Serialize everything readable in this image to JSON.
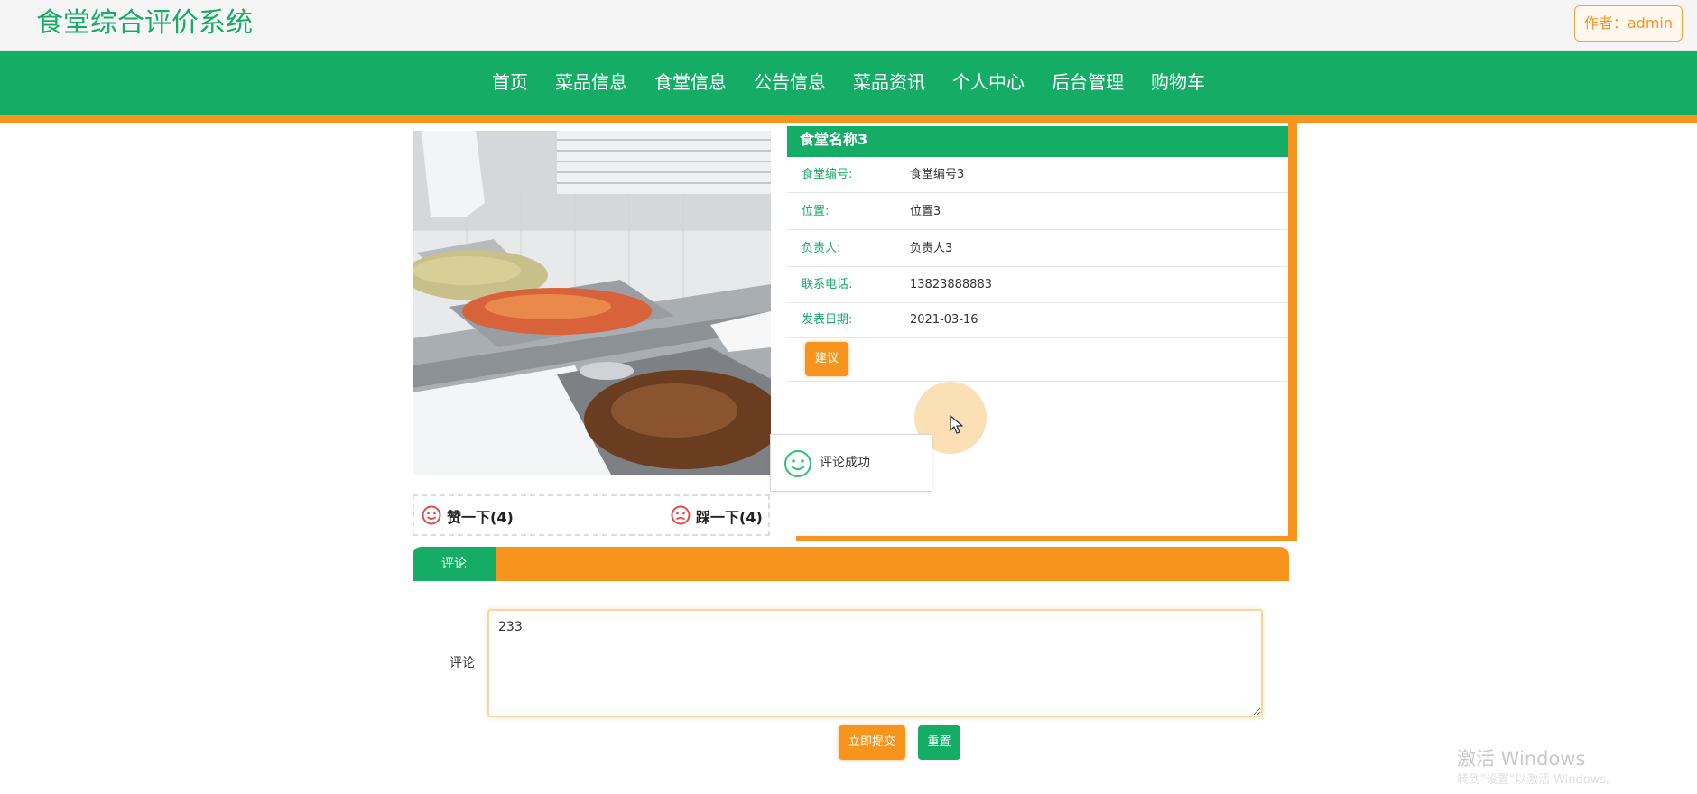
{
  "header": {
    "site_title": "食堂综合评价系统",
    "author": "作者：admin"
  },
  "nav": {
    "items": [
      "首页",
      "菜品信息",
      "食堂信息",
      "公告信息",
      "菜品资讯",
      "个人中心",
      "后台管理",
      "购物车"
    ]
  },
  "canteen": {
    "name": "食堂名称3",
    "fields": [
      {
        "label": "食堂编号:",
        "value": "食堂编号3"
      },
      {
        "label": "位置:",
        "value": "位置3"
      },
      {
        "label": "负责人:",
        "value": "负责人3"
      },
      {
        "label": "联系电话:",
        "value": "13823888883"
      },
      {
        "label": "发表日期:",
        "value": "2021-03-16"
      }
    ],
    "suggest_label": "建议"
  },
  "votes": {
    "like": "赞一下(4)",
    "dislike": "踩一下(4)"
  },
  "toast": {
    "message": "评论成功"
  },
  "comment": {
    "tab_label": "评论",
    "field_label": "评论",
    "value": "233",
    "submit_label": "立即提交",
    "reset_label": "重置"
  },
  "watermark": {
    "line1": "激活 Windows",
    "line2": "转到\"设置\"以激活 Windows。"
  },
  "colors": {
    "primary": "#15ad66",
    "accent": "#f7941d"
  }
}
